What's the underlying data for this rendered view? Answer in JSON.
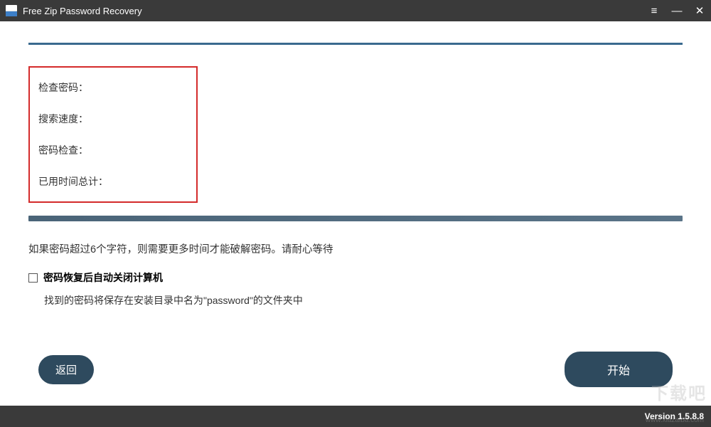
{
  "titlebar": {
    "title": "Free Zip Password Recovery",
    "menu_icon": "≡",
    "minimize": "—",
    "close": "✕"
  },
  "status": {
    "check_password_label": "检查密码：",
    "search_speed_label": "搜索速度：",
    "password_check_label": "密码检查：",
    "elapsed_time_label": "已用时间总计："
  },
  "hint": "如果密码超过6个字符，则需要更多时间才能破解密码。请耐心等待",
  "checkbox_label": "密码恢复后自动关闭计算机",
  "note": "找到的密码将保存在安装目录中名为\"password\"的文件夹中",
  "buttons": {
    "back": "返回",
    "start": "开始"
  },
  "footer": {
    "version": "Version 1.5.8.8"
  },
  "watermark": {
    "text": "下载吧",
    "url": "www.xiazaiba.com"
  }
}
